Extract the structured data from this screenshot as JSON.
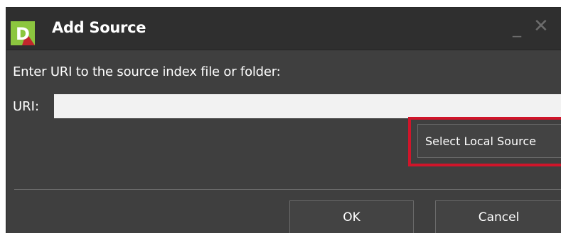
{
  "window": {
    "title": "Add Source",
    "minimize_glyph": "_",
    "close_glyph": "✕",
    "icon": "app-logo-d-icon"
  },
  "form": {
    "prompt": "Enter URI to the source index file or folder:",
    "uri_label": "URI:",
    "uri_value": "",
    "uri_placeholder": ""
  },
  "buttons": {
    "select_local_source": "Select Local Source",
    "ok": "OK",
    "cancel": "Cancel"
  },
  "colors": {
    "window_bg": "#3f3f3f",
    "titlebar_bg": "#2f2f2f",
    "highlight": "#d0152a",
    "logo_green": "#8cc63f",
    "logo_red": "#c1272d"
  }
}
